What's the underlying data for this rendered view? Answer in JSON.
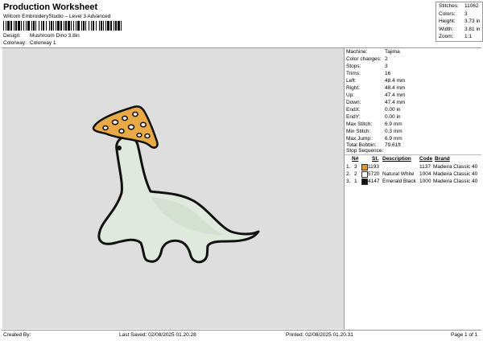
{
  "header": {
    "title": "Production Worksheet",
    "subtitle": "Wilcom EmbroideryStudio – Level 3 Advanced",
    "design_label": "Design:",
    "design_value": "Mushroom Dino 3.8in",
    "colorway_label": "Colorway:",
    "colorway_value": "Colorway 1"
  },
  "summary": [
    {
      "label": "Stitches:",
      "value": "11062"
    },
    {
      "label": "Colors:",
      "value": "3"
    },
    {
      "label": "Height:",
      "value": "3.73 in"
    },
    {
      "label": "Width:",
      "value": "3.81 in"
    },
    {
      "label": "Zoom:",
      "value": "1:1"
    }
  ],
  "specs": [
    {
      "label": "Machine:",
      "value": "Tajima"
    },
    {
      "label": "Color changes:",
      "value": "2"
    },
    {
      "label": "Stops:",
      "value": "3"
    },
    {
      "label": "Trims:",
      "value": "16"
    },
    {
      "label": "Left:",
      "value": "48.4 mm"
    },
    {
      "label": "Right:",
      "value": "48.4 mm"
    },
    {
      "label": "Up:",
      "value": "47.4 mm"
    },
    {
      "label": "Down:",
      "value": "47.4 mm"
    },
    {
      "label": "EndX:",
      "value": "0.00 in"
    },
    {
      "label": "EndY:",
      "value": "0.00 in"
    },
    {
      "label": "Max Stitch:",
      "value": "6.9 mm"
    },
    {
      "label": "Min Stitch:",
      "value": "0.3 mm"
    },
    {
      "label": "Max Jump:",
      "value": "6.9 mm"
    },
    {
      "label": "Total Bobbin:",
      "value": "79.61ft"
    }
  ],
  "stop_sequence": {
    "heading": "Stop Sequence:",
    "headers": {
      "n": "N#",
      "st": "St.",
      "description": "Description",
      "code": "Code",
      "brand": "Brand"
    },
    "rows": [
      {
        "idx": "1.",
        "n": "3",
        "color": "#e8952a",
        "st": "1193",
        "description": "",
        "code": "1137",
        "brand": "Madeira Classic 40"
      },
      {
        "idx": "2.",
        "n": "2",
        "color": "#ffffff",
        "st": "5720",
        "description": "Natural White",
        "code": "1004",
        "brand": "Madeira Classic 40"
      },
      {
        "idx": "3.",
        "n": "1",
        "color": "#111111",
        "st": "4147",
        "description": "Emerald Black",
        "code": "1000",
        "brand": "Madeira Classic 40"
      }
    ]
  },
  "footer": {
    "created_by": "Created By:",
    "last_saved": "Last Saved: 02/08/2025 01.20.28",
    "printed": "Printed: 02/08/2025 01.20.31",
    "page": "Page 1 of 1"
  }
}
